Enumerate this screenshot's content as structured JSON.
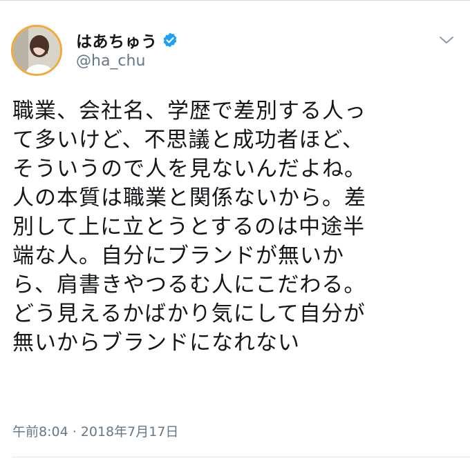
{
  "user": {
    "display_name": "はあちゅう",
    "handle": "@ha_chu",
    "verified": true,
    "avatar_icon": "profile-photo",
    "accent_color": "#1da1f2"
  },
  "tweet": {
    "text": "職業、会社名、学歴で差別する人って多いけど、不思議と成功者ほど、\nそういうので人を見ないんだよね。\n人の本質は職業と関係ないから。差別して上に立とうとするのは中途半端な人。自分にブランドが無いから、肩書きやつるむ人にこだわる。\nどう見えるかばかり気にして自分が無いからブランドになれない",
    "lines": [
      "職業、会社名、学歴で差別する人っ",
      "て多いけど、不思議と成功者ほど、",
      "そういうので人を見ないんだよね。",
      "人の本質は職業と関係ないから。差",
      "別して上に立とうとするのは中途半",
      "端な人。自分にブランドが無いか",
      "ら、肩書きやつるむ人にこだわる。",
      "どう見えるかばかり気にして自分が",
      "無いからブランドになれない"
    ],
    "timestamp": "午前8:04 · 2018年7月17日"
  },
  "icons": {
    "verified": "verified-badge-icon",
    "caret": "chevron-down-icon"
  }
}
